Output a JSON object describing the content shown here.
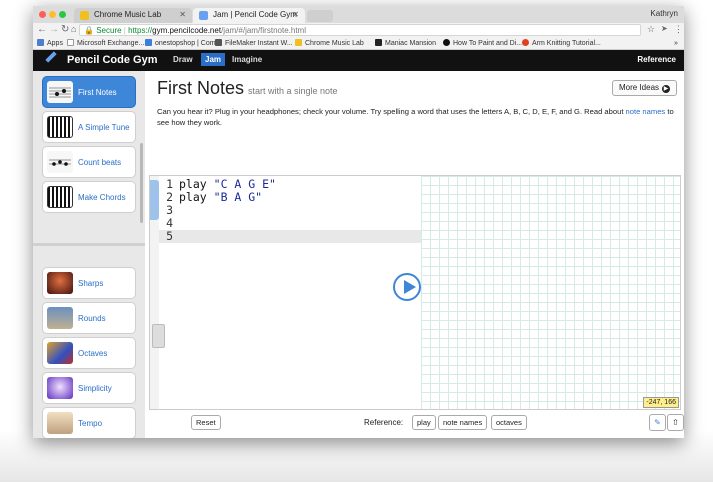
{
  "browser": {
    "profile_name": "Kathryn",
    "tabs": [
      {
        "title": "Chrome Music Lab",
        "active": false
      },
      {
        "title": "Jam | Pencil Code Gym",
        "active": true
      }
    ],
    "url": {
      "secure_label": "Secure",
      "scheme": "https://",
      "domain": "gym.pencilcode.net",
      "path": "/jam/#/jam/firstnote.html"
    },
    "bookmarks": [
      "Apps",
      "Microsoft Exchange...",
      "onestopshop | Com...",
      "FileMaker Instant W...",
      "Chrome Music Lab",
      "Maniac Mansion",
      "How To Paint and Di...",
      "Arm Knitting Tutorial..."
    ],
    "bookmarks_overflow": "»"
  },
  "app": {
    "brand": "Pencil Code Gym",
    "nav": [
      "Draw",
      "Jam",
      "Imagine"
    ],
    "nav_selected": "Jam",
    "reference": "Reference"
  },
  "sidebar": {
    "items": [
      {
        "label": "First Notes",
        "selected": true,
        "icon": "staff-notes-icon"
      },
      {
        "label": "A Simple Tune",
        "selected": false,
        "icon": "piano-keys-icon"
      },
      {
        "label": "Count beats",
        "selected": false,
        "icon": "rhythm-notes-icon"
      },
      {
        "label": "Make Chords",
        "selected": false,
        "icon": "piano-keys-icon"
      },
      {
        "label": "Sharps",
        "selected": false,
        "icon": "concert-photo-icon"
      },
      {
        "label": "Rounds",
        "selected": false,
        "icon": "building-photo-icon"
      },
      {
        "label": "Octaves",
        "selected": false,
        "icon": "cartoon-photo-icon"
      },
      {
        "label": "Simplicity",
        "selected": false,
        "icon": "dancer-photo-icon"
      },
      {
        "label": "Tempo",
        "selected": false,
        "icon": "person-photo-icon"
      }
    ]
  },
  "main": {
    "title": "First Notes",
    "subtitle": "start with a single note",
    "more_ideas": "More Ideas",
    "description_before": "Can you hear it? Plug in your headphones; check your volume. Try spelling a word that uses the letters A, B, C, D, E, F, and G. Read about ",
    "description_link": "note names",
    "description_after": " to see how they work."
  },
  "editor": {
    "lines": [
      {
        "num": "1",
        "keyword": "play",
        "string": "\"C A G E\""
      },
      {
        "num": "2",
        "keyword": "play",
        "string": "\"B A G\""
      },
      {
        "num": "3",
        "keyword": "",
        "string": ""
      },
      {
        "num": "4",
        "keyword": "",
        "string": ""
      },
      {
        "num": "5",
        "keyword": "",
        "string": ""
      }
    ],
    "current_line": 5,
    "coords": "-247, 166"
  },
  "bottom": {
    "reset": "Reset",
    "reference_label": "Reference:",
    "refs": [
      "play",
      "note names",
      "octaves"
    ]
  },
  "colors": {
    "accent": "#3d86d8",
    "header_bg": "#111111",
    "secure_green": "#0a8a2e"
  }
}
